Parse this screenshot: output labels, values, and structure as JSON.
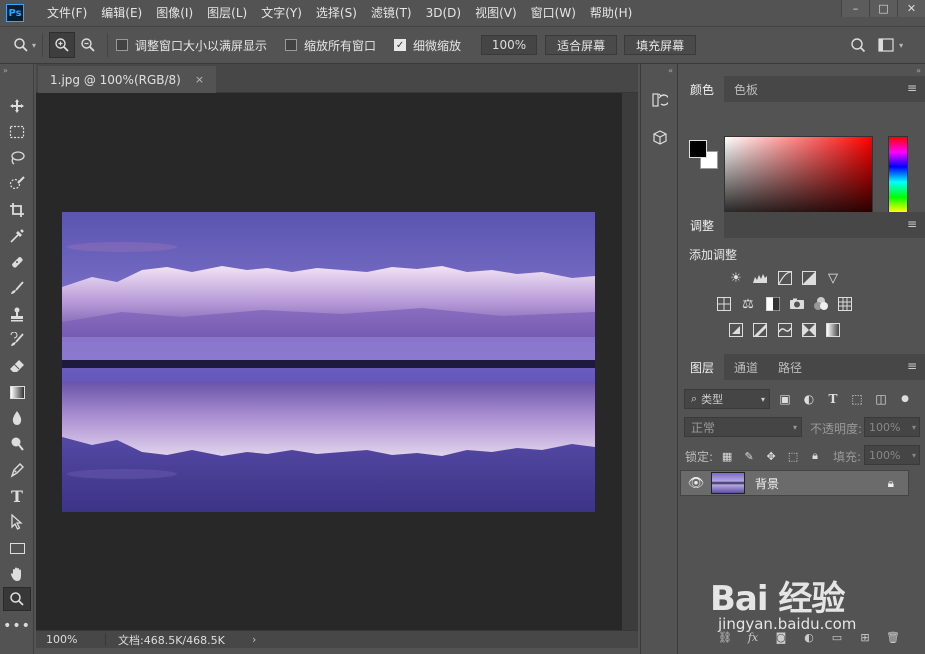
{
  "app": {
    "logo_text": "Ps",
    "menu": [
      "文件(F)",
      "编辑(E)",
      "图像(I)",
      "图层(L)",
      "文字(Y)",
      "选择(S)",
      "滤镜(T)",
      "3D(D)",
      "视图(V)",
      "窗口(W)",
      "帮助(H)"
    ],
    "window_controls": {
      "minimize": "–",
      "maximize": "□",
      "close": "✕"
    }
  },
  "options_bar": {
    "tool_icon": "magnifier-icon",
    "zoom_in_icon": "zoom-in-icon",
    "zoom_out_icon": "zoom-out-icon",
    "resize_windows_label": "调整窗口大小以满屏显示",
    "resize_windows_checked": false,
    "zoom_all_label": "缩放所有窗口",
    "zoom_all_checked": false,
    "scrubby_zoom_label": "细微缩放",
    "scrubby_zoom_checked": true,
    "zoom_value": "100%",
    "fit_screen_label": "适合屏幕",
    "fill_screen_label": "填充屏幕"
  },
  "document": {
    "tab_title": "1.jpg @ 100%(RGB/8)",
    "tab_close": "×",
    "status_zoom": "100%",
    "status_doc": "文档:468.5K/468.5K",
    "status_arrow": "›"
  },
  "panels": {
    "color": {
      "tabs": [
        "颜色",
        "色板"
      ],
      "active_tab": 0,
      "foreground": "#000000",
      "background": "#ffffff"
    },
    "adjustments": {
      "tab": "调整",
      "title": "添加调整"
    },
    "layers": {
      "tabs": [
        "图层",
        "通道",
        "路径"
      ],
      "active_tab": 0,
      "filter_label": "类型",
      "blend_mode": "正常",
      "opacity_label": "不透明度:",
      "opacity_value": "100%",
      "lock_label": "锁定:",
      "fill_label": "填充:",
      "fill_value": "100%",
      "layer_name": "背景",
      "footer_icons": [
        "link-icon",
        "fx-icon",
        "mask-icon",
        "adjustment-layer-icon",
        "group-icon",
        "new-layer-icon",
        "trash-icon"
      ]
    }
  },
  "watermark": {
    "title": "Bai 经验",
    "subtitle": "jingyan.baidu.com"
  }
}
